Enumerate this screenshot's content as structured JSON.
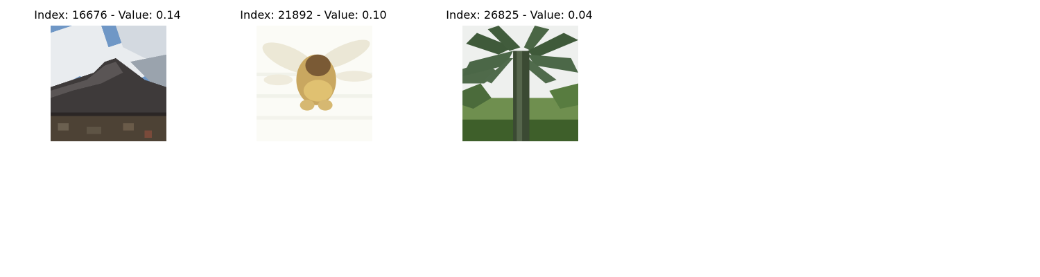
{
  "panels": [
    {
      "title": "Index: 16676 - Value: 0.14",
      "image_subject": "mountain-sky-image"
    },
    {
      "title": "Index: 21892 - Value: 0.10",
      "image_subject": "flying-insect-image"
    },
    {
      "title": "Index: 26825 - Value: 0.04",
      "image_subject": "palm-tree-image"
    }
  ]
}
